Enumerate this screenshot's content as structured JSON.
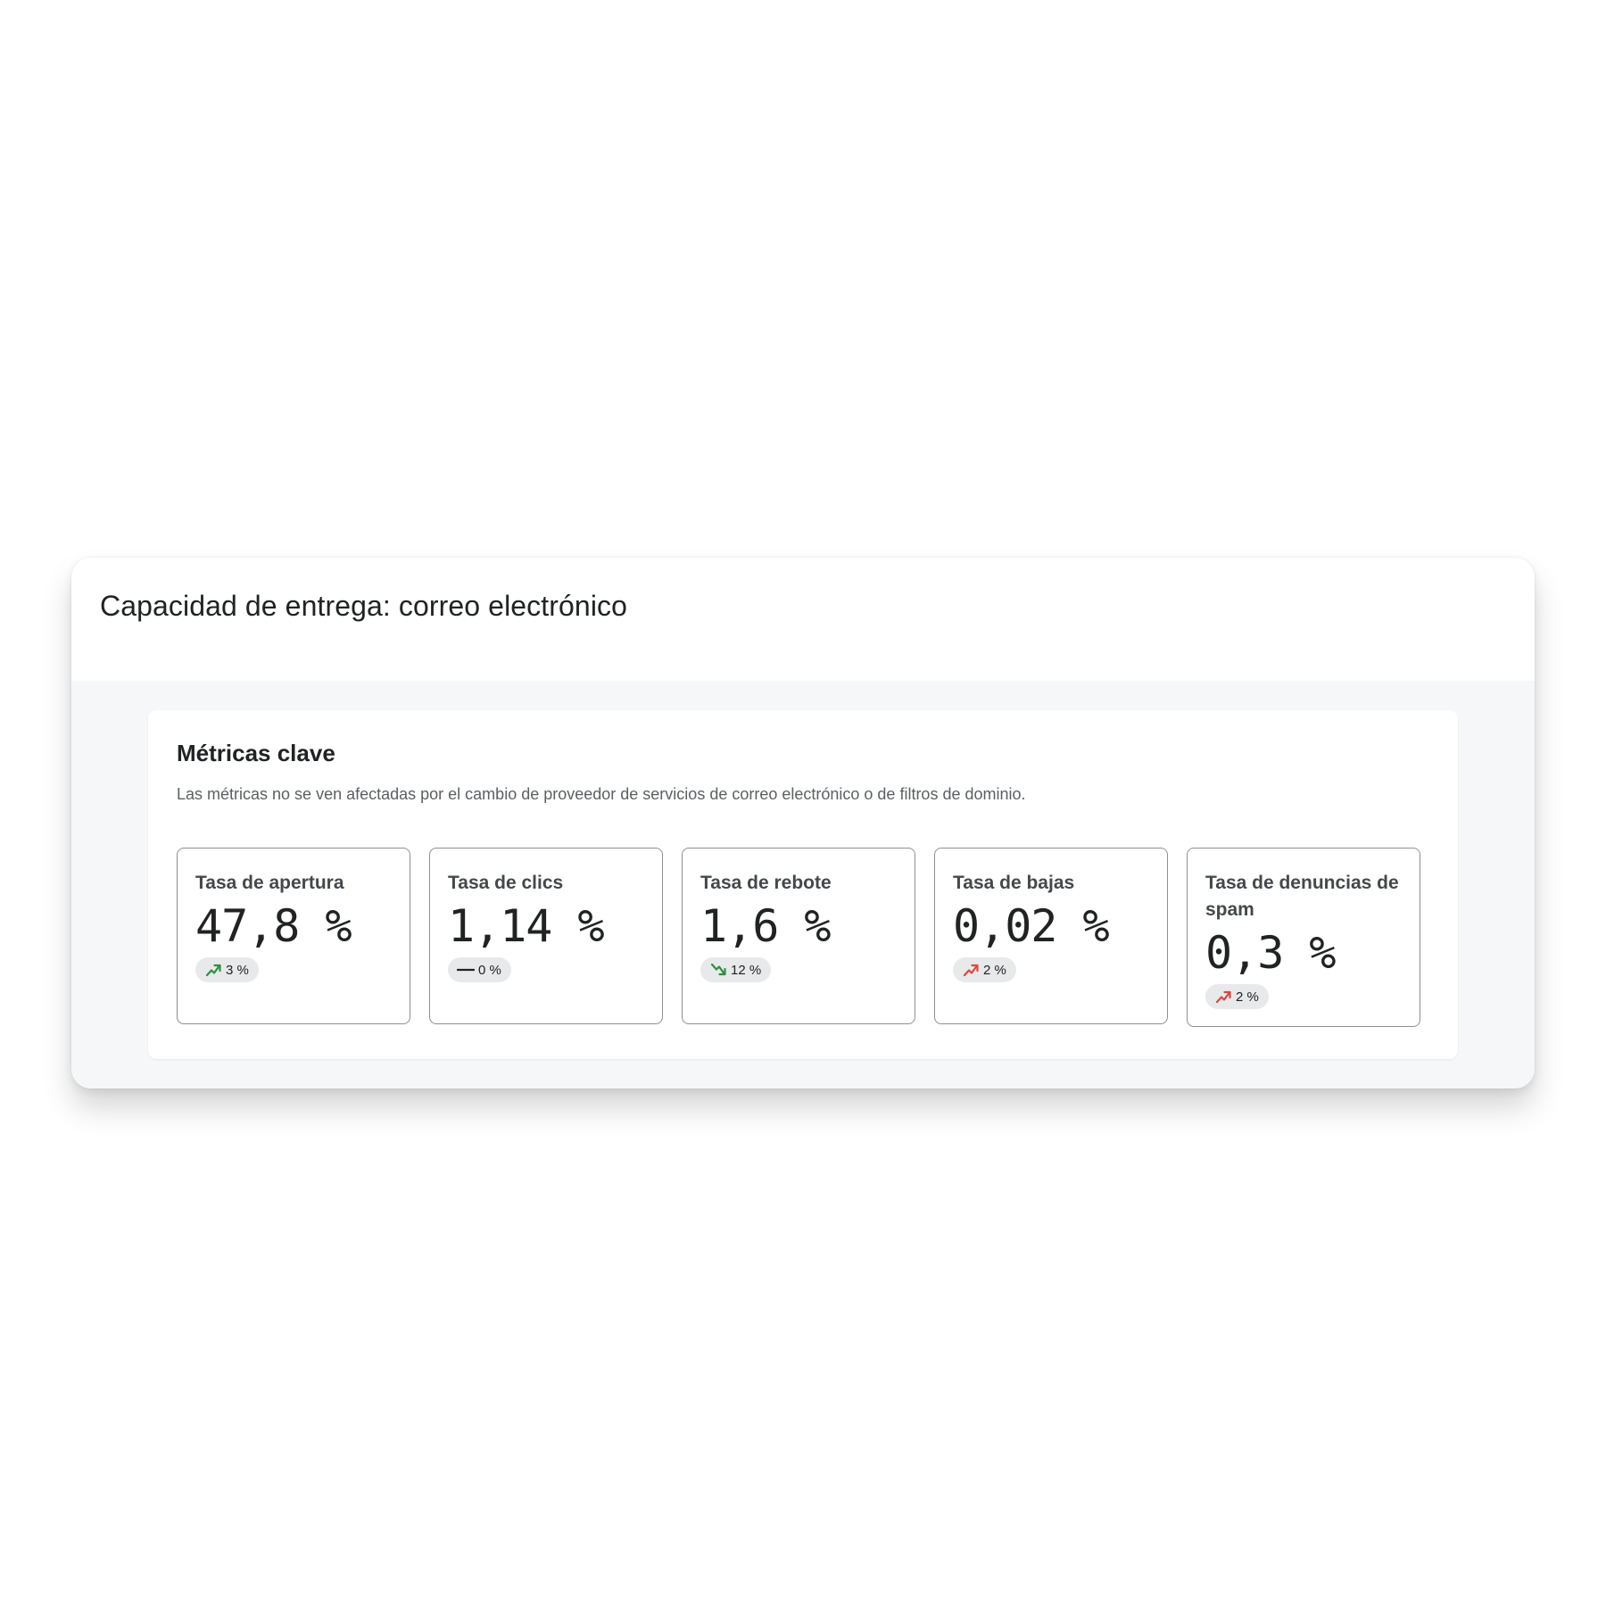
{
  "header": {
    "title": "Capacidad de entrega: correo electrónico"
  },
  "metrics": {
    "title": "Métricas clave",
    "subtitle": "Las métricas no se ven afectadas por el cambio de proveedor de servicios de correo electrónico o de filtros de dominio.",
    "tiles": [
      {
        "label": "Tasa de apertura",
        "value": "47,8 %",
        "change": "3 %",
        "trend": "up",
        "trend_color": "#2e8f3a",
        "icon": "trend-up-icon"
      },
      {
        "label": "Tasa de clics",
        "value": "1,14 %",
        "change": "0 %",
        "trend": "flat",
        "trend_color": "#202223",
        "icon": "dash-icon"
      },
      {
        "label": "Tasa de rebote",
        "value": "1,6 %",
        "change": "12 %",
        "trend": "down",
        "trend_color": "#2e8f3a",
        "icon": "trend-down-icon"
      },
      {
        "label": "Tasa de bajas",
        "value": "0,02 %",
        "change": "2 %",
        "trend": "up",
        "trend_color": "#d8493f",
        "icon": "trend-up-icon"
      },
      {
        "label": "Tasa de denuncias de spam",
        "value": "0,3 %",
        "change": "2 %",
        "trend": "up",
        "trend_color": "#d8493f",
        "icon": "trend-up-icon"
      }
    ]
  }
}
